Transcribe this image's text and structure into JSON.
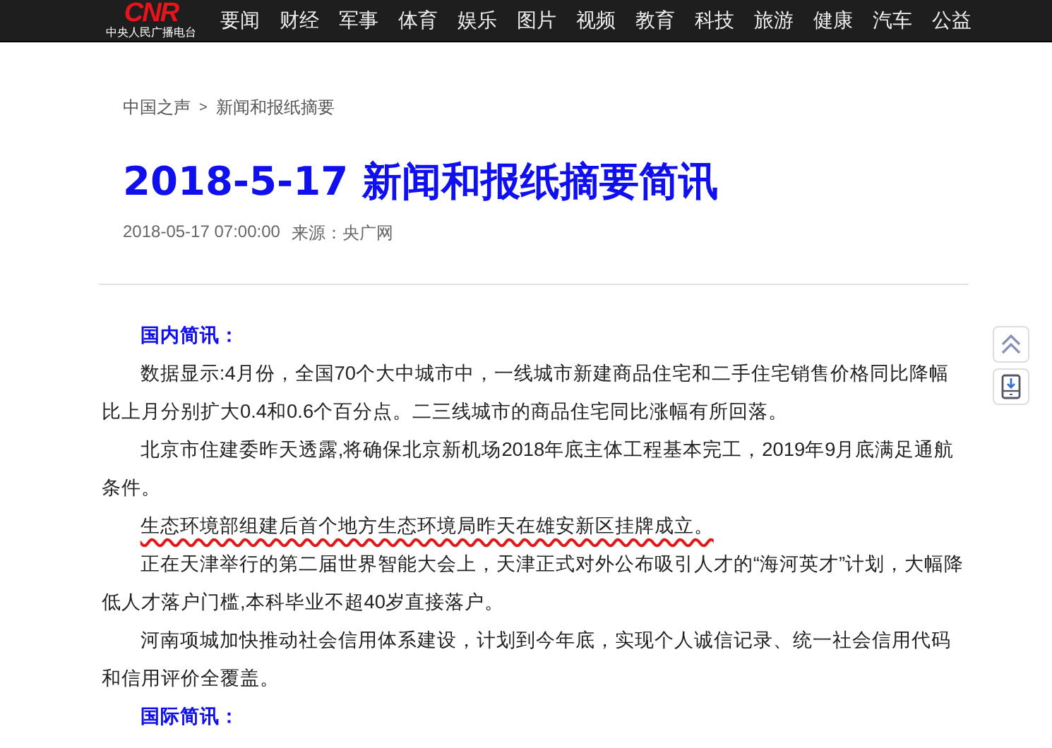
{
  "logo": {
    "mark": "CNR",
    "subtitle": "中央人民广播电台"
  },
  "nav": [
    "要闻",
    "财经",
    "军事",
    "体育",
    "娱乐",
    "图片",
    "视频",
    "教育",
    "科技",
    "旅游",
    "健康",
    "汽车",
    "公益"
  ],
  "breadcrumb": [
    "中国之声",
    "新闻和报纸摘要"
  ],
  "breadcrumb_separator": ">",
  "title": "2018-5-17 新闻和报纸摘要简讯",
  "meta": {
    "time": "2018-05-17 07:00:00",
    "source": "来源：央广网"
  },
  "paragraphs": [
    {
      "kind": "heading",
      "text": "国内简讯："
    },
    {
      "kind": "text",
      "text": "数据显示:4月份，全国70个大中城市中，一线城市新建商品住宅和二手住宅销售价格同比降幅比上月分别扩大0.4和0.6个百分点。二三线城市的商品住宅同比涨幅有所回落。"
    },
    {
      "kind": "text",
      "text": "北京市住建委昨天透露,将确保北京新机场2018年底主体工程基本完工，2019年9月底满足通航条件。"
    },
    {
      "kind": "underlined",
      "text": "生态环境部组建后首个地方生态环境局昨天在雄安新区挂牌成立。"
    },
    {
      "kind": "text",
      "text": "正在天津举行的第二届世界智能大会上，天津正式对外公布吸引人才的“海河英才”计划，大幅降低人才落户门槛,本科毕业不超40岁直接落户。"
    },
    {
      "kind": "text",
      "text": "河南项城加快推动社会信用体系建设，计划到今年底，实现个人诚信记录、统一社会信用代码和信用评价全覆盖。"
    },
    {
      "kind": "heading",
      "text": "国际简讯："
    }
  ]
}
